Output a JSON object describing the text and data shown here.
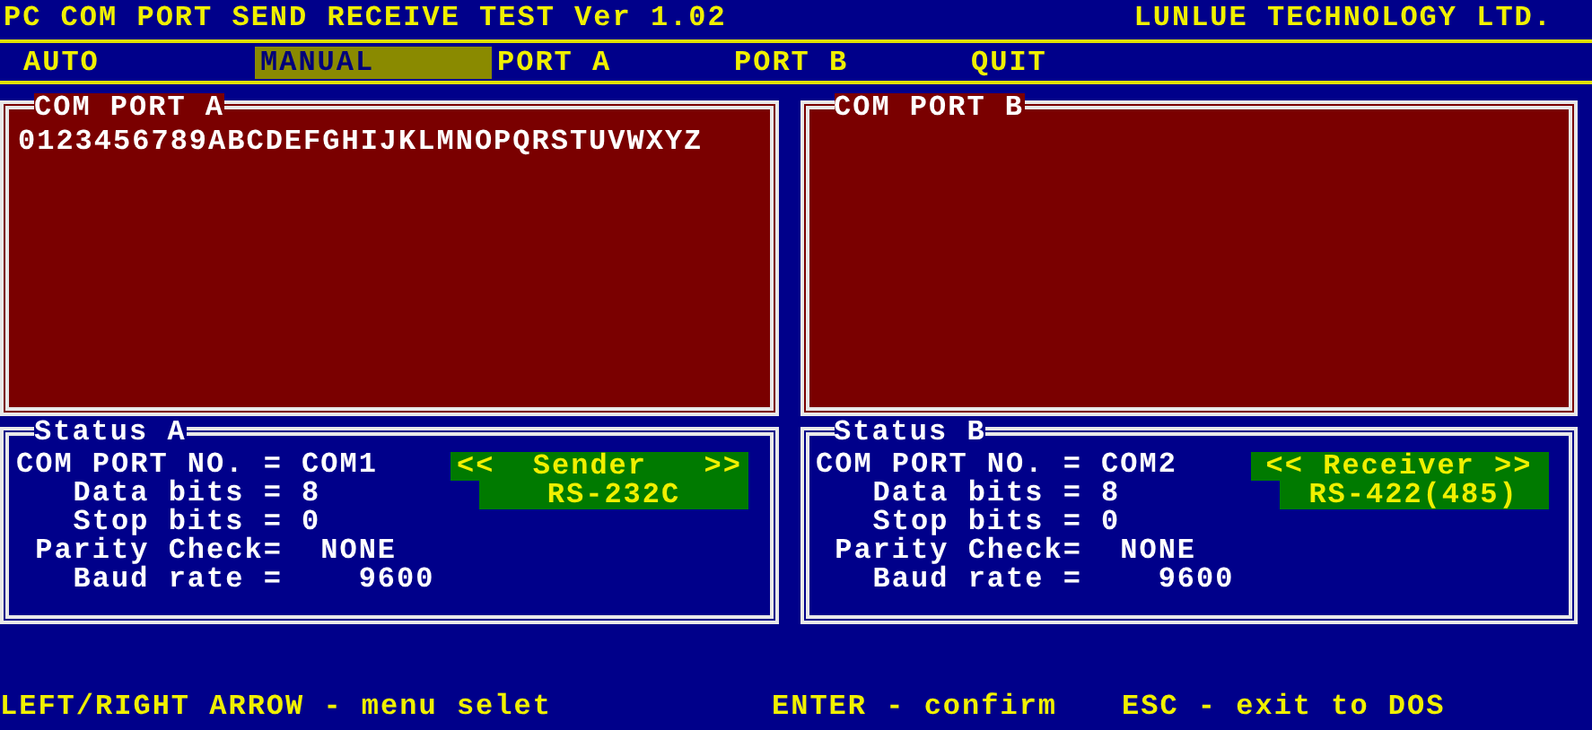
{
  "title": "PC COM PORT SEND RECEIVE TEST Ver 1.02",
  "company": "LUNLUE TECHNOLOGY LTD.",
  "menu": [
    {
      "label": "AUTO",
      "selected": false
    },
    {
      "label": "MANUAL",
      "selected": true
    },
    {
      "label": "PORT A",
      "selected": false
    },
    {
      "label": "PORT B",
      "selected": false
    },
    {
      "label": "QUIT",
      "selected": false
    }
  ],
  "ports": [
    {
      "title": "COM PORT A",
      "text": "0123456789ABCDEFGHIJKLMNOPQRSTUVWXYZ"
    },
    {
      "title": "COM PORT B"
    }
  ],
  "status": [
    {
      "title": "Status A",
      "lines": [
        "COM PORT NO. = COM1",
        "   Data bits = 8",
        "   Stop bits = 0",
        " Parity Check=  NONE",
        "   Baud rate =    9600"
      ],
      "role": "<<  Sender   >>",
      "interface": "RS-232C"
    },
    {
      "title": "Status B",
      "lines": [
        "COM PORT NO. = COM2",
        "   Data bits = 8",
        "   Stop bits = 0",
        " Parity Check=  NONE",
        "   Baud rate =    9600"
      ],
      "role": "<< Receiver >>",
      "interface": "RS-422(485)"
    }
  ],
  "footer": [
    "LEFT/RIGHT ARROW - menu selet",
    "ENTER - confirm",
    "ESC - exit to DOS"
  ]
}
